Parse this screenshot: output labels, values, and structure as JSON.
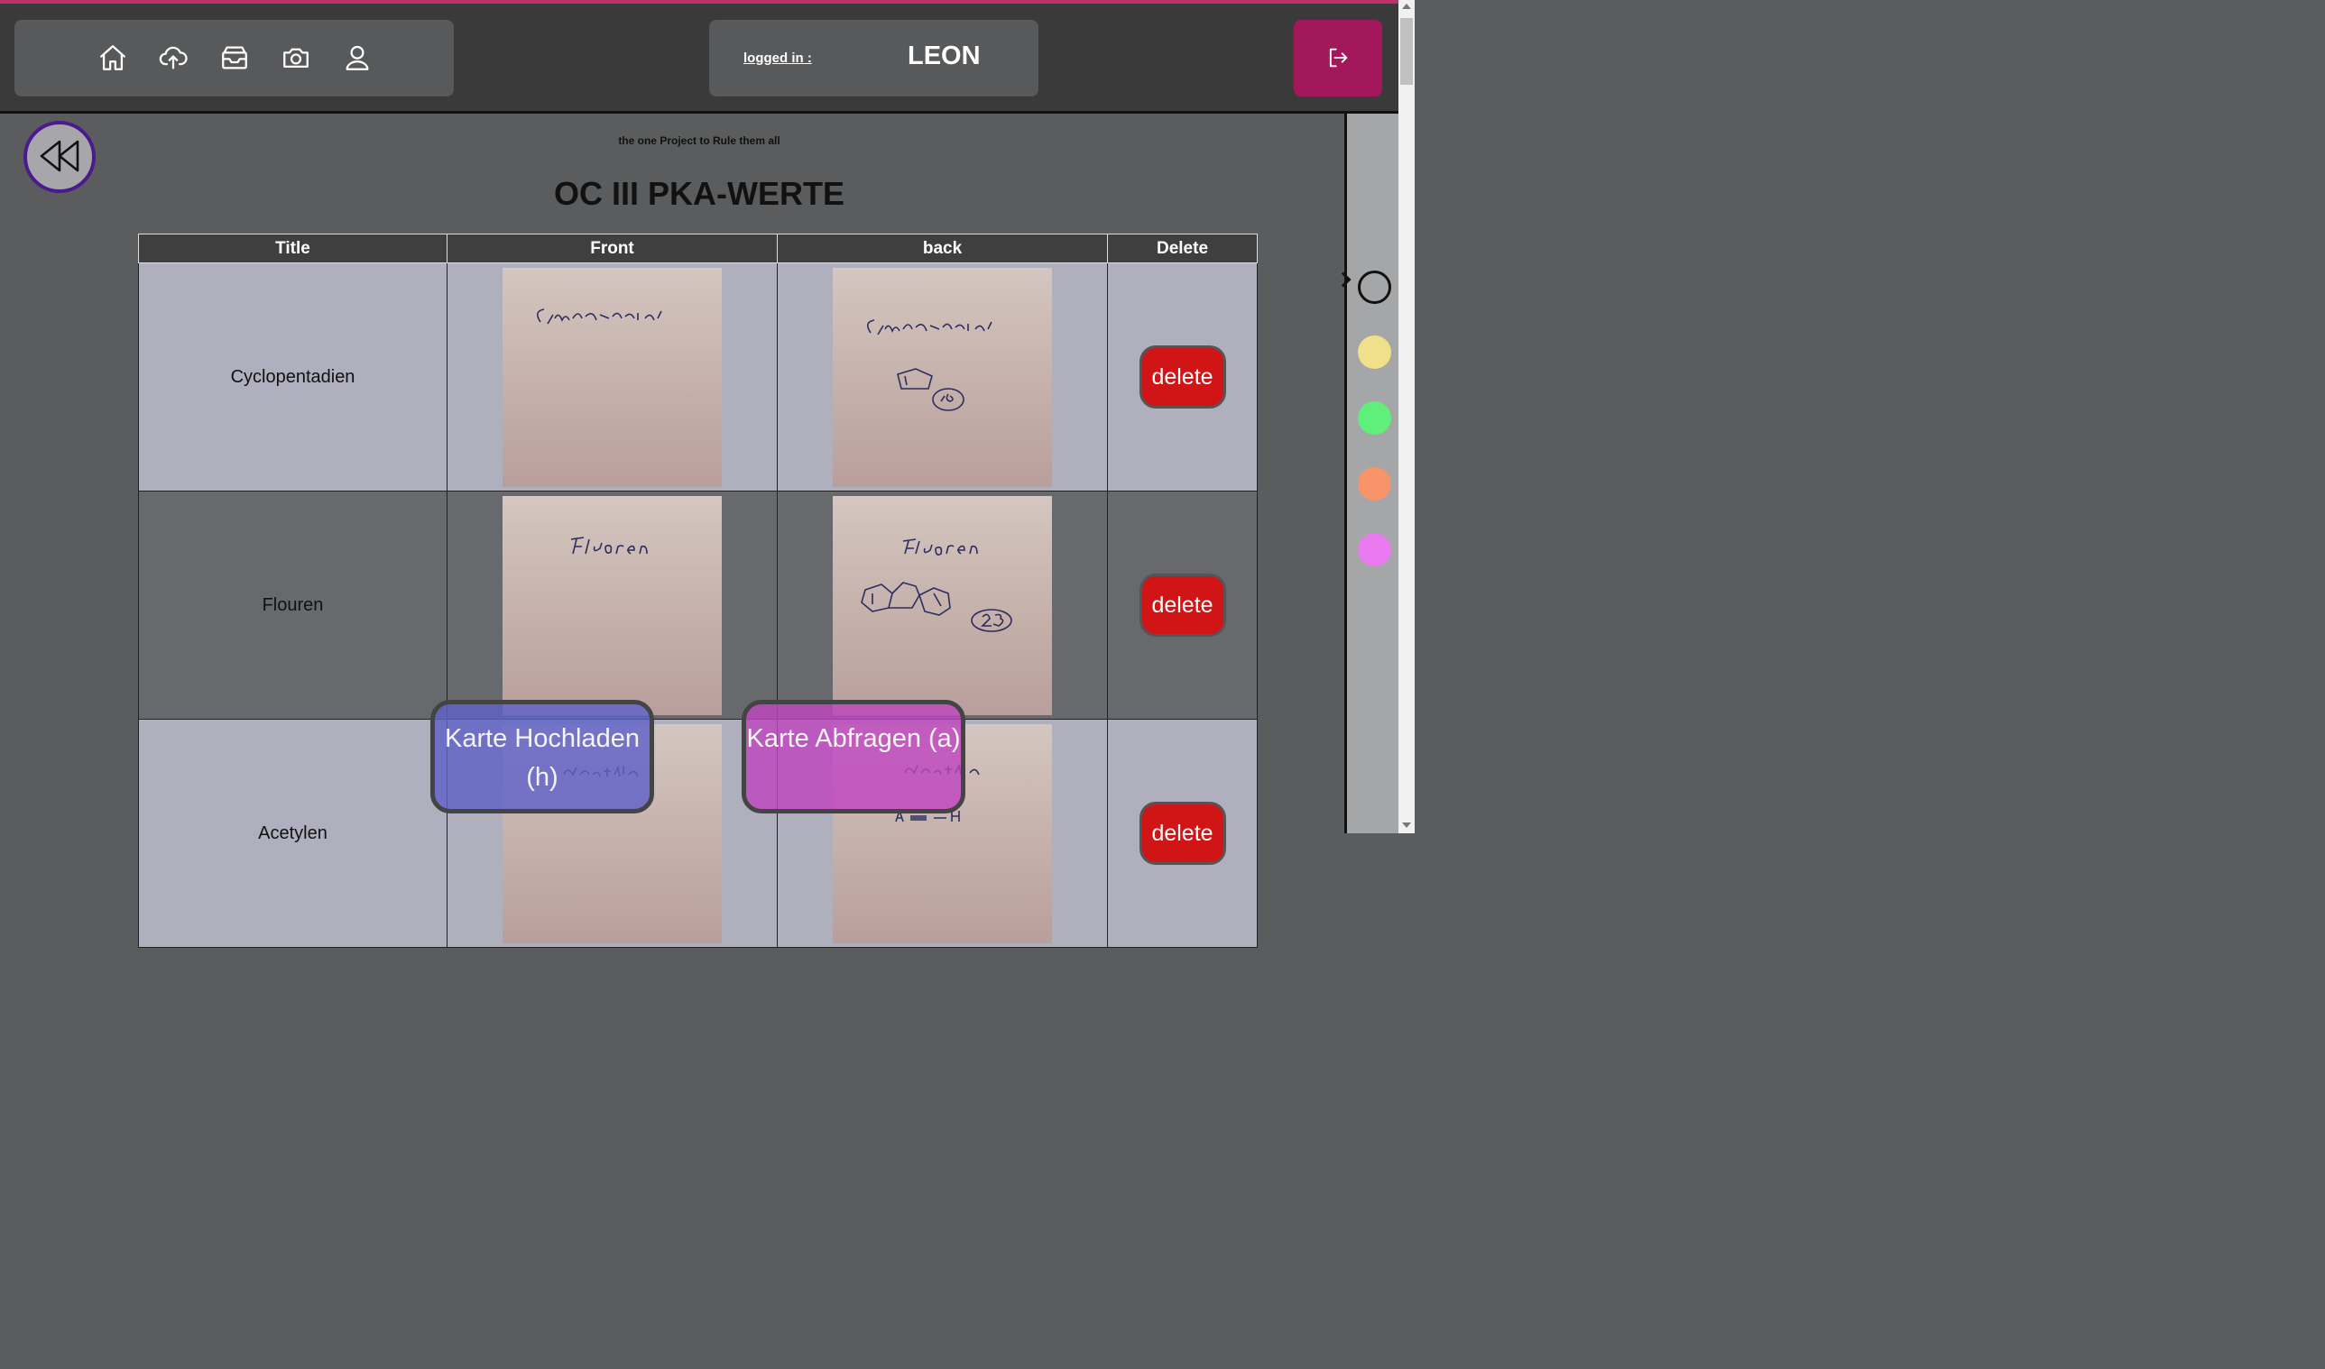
{
  "header": {
    "nav_icons": [
      "home-icon",
      "cloud-upload-icon",
      "inbox-icon",
      "camera-icon",
      "user-icon"
    ],
    "login_label": "logged in :",
    "username": "LEON",
    "logout_icon": "logout-icon"
  },
  "page": {
    "subtitle": "the one Project to Rule them all",
    "title": "OC III PKA-WERTE"
  },
  "table": {
    "headers": [
      "Title",
      "Front",
      "back",
      "Delete"
    ],
    "rows": [
      {
        "title": "Cyclopentadien",
        "delete_label": "delete"
      },
      {
        "title": "Flouren",
        "delete_label": "delete"
      },
      {
        "title": "Acetylen",
        "delete_label": "delete"
      }
    ]
  },
  "sidebar": {
    "colors": [
      "#111111",
      "#f0e08a",
      "#5ef07a",
      "#f7946a",
      "#e97af0"
    ]
  },
  "buttons": {
    "upload": "Karte Hochladen (h)",
    "query": "Karte Abfragen (a)"
  }
}
